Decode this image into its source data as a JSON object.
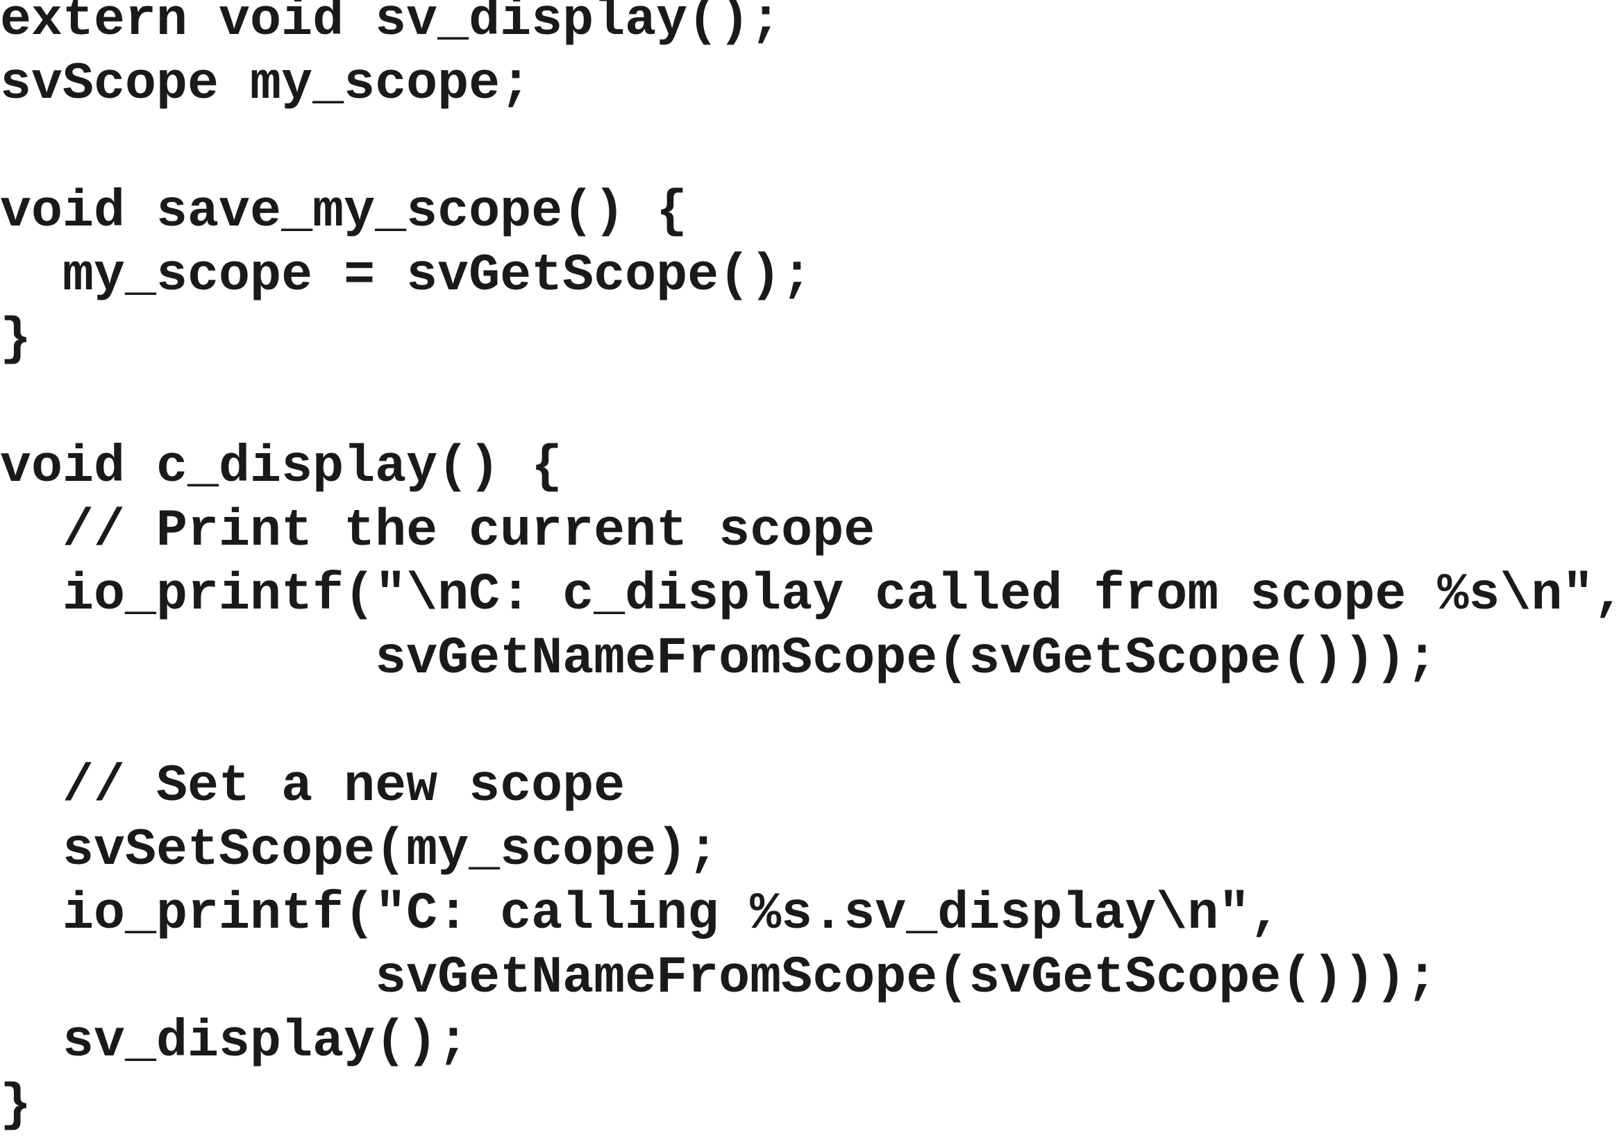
{
  "code": {
    "lines": [
      "extern void sv_display();",
      "svScope my_scope;",
      "",
      "void save_my_scope() {",
      "  my_scope = svGetScope();",
      "}",
      "",
      "void c_display() {",
      "  // Print the current scope",
      "  io_printf(\"\\nC: c_display called from scope %s\\n\",",
      "            svGetNameFromScope(svGetScope()));",
      "",
      "  // Set a new scope",
      "  svSetScope(my_scope);",
      "  io_printf(\"C: calling %s.sv_display\\n\",",
      "            svGetNameFromScope(svGetScope()));",
      "  sv_display();",
      "}"
    ]
  }
}
